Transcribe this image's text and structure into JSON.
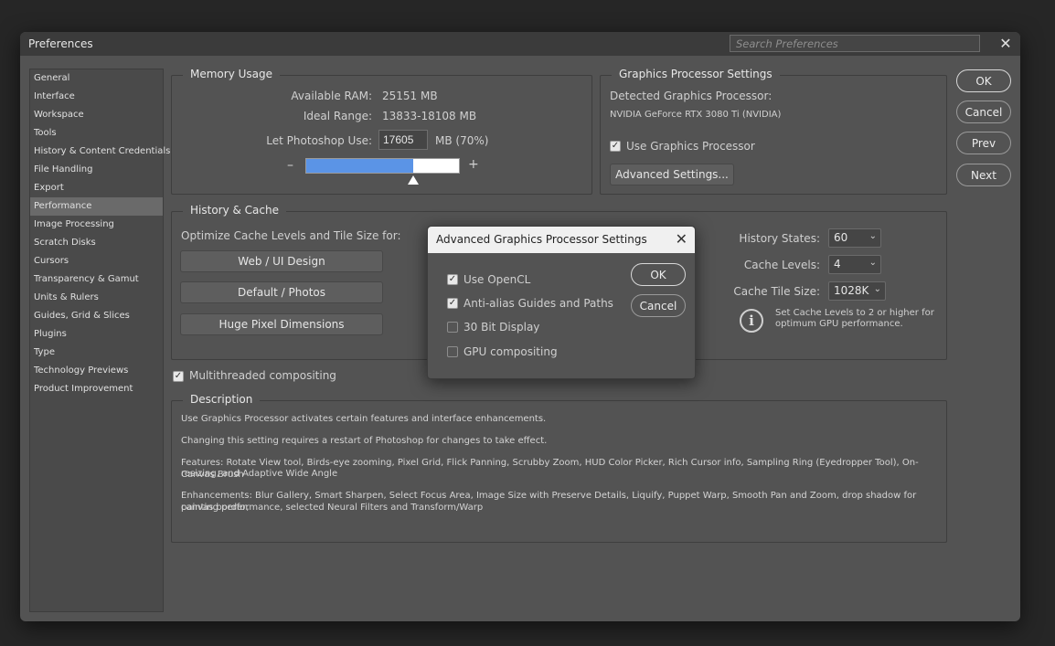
{
  "window": {
    "title": "Preferences",
    "search_placeholder": "Search Preferences",
    "close": "✕"
  },
  "sidebar": {
    "items": [
      {
        "label": "General"
      },
      {
        "label": "Interface"
      },
      {
        "label": "Workspace"
      },
      {
        "label": "Tools"
      },
      {
        "label": "History & Content Credentials"
      },
      {
        "label": "File Handling"
      },
      {
        "label": "Export"
      },
      {
        "label": "Performance",
        "active": true
      },
      {
        "label": "Image Processing"
      },
      {
        "label": "Scratch Disks"
      },
      {
        "label": "Cursors"
      },
      {
        "label": "Transparency & Gamut"
      },
      {
        "label": "Units & Rulers"
      },
      {
        "label": "Guides, Grid & Slices"
      },
      {
        "label": "Plugins"
      },
      {
        "label": "Type"
      },
      {
        "label": "Technology Previews"
      },
      {
        "label": "Product Improvement"
      }
    ]
  },
  "memory": {
    "title": "Memory Usage",
    "available_label": "Available RAM:",
    "available_value": "25151 MB",
    "ideal_label": "Ideal Range:",
    "ideal_value": "13833-18108 MB",
    "use_label": "Let Photoshop Use:",
    "use_value": "17605",
    "use_unit": "MB (70%)",
    "minus": "–",
    "plus": "+",
    "slider_fraction": 0.7
  },
  "gpu": {
    "title": "Graphics Processor Settings",
    "detected_label": "Detected Graphics Processor:",
    "detected_value": "NVIDIA GeForce RTX 3080 Ti (NVIDIA)",
    "use_gpu_label": "Use Graphics Processor",
    "use_gpu_checked": true,
    "advanced_button": "Advanced Settings..."
  },
  "history_cache": {
    "title": "History & Cache",
    "optimize_label": "Optimize Cache Levels and Tile Size for:",
    "presets": [
      "Web / UI Design",
      "Default / Photos",
      "Huge Pixel Dimensions"
    ],
    "history_states_label": "History States:",
    "history_states_value": "60",
    "cache_levels_label": "Cache Levels:",
    "cache_levels_value": "4",
    "cache_tile_label": "Cache Tile Size:",
    "cache_tile_value": "1028K",
    "info_text_1": "Set Cache Levels to 2 or higher for",
    "info_text_2": "optimum GPU performance."
  },
  "multithreaded": {
    "label": "Multithreaded compositing",
    "checked": true
  },
  "description": {
    "title": "Description",
    "lines": [
      "Use Graphics Processor activates certain features and interface enhancements.",
      "Changing this setting requires a restart of Photoshop for changes to take effect.",
      "Features: Rotate View tool, Birds-eye zooming, Pixel Grid, Flick Panning, Scrubby Zoom, HUD Color Picker, Rich Cursor info, Sampling Ring (Eyedropper Tool), On-Canvas Brush",
      "resizing, and Adaptive Wide Angle",
      "Enhancements: Blur Gallery, Smart Sharpen, Select Focus Area, Image Size with Preserve Details, Liquify, Puppet Warp, Smooth Pan and Zoom, drop shadow for canvas border,",
      "painting performance, selected Neural Filters and Transform/Warp"
    ]
  },
  "actions": {
    "ok": "OK",
    "cancel": "Cancel",
    "prev": "Prev",
    "next": "Next"
  },
  "advanced_dialog": {
    "title": "Advanced Graphics Processor Settings",
    "close": "✕",
    "options": [
      {
        "label": "Use OpenCL",
        "checked": true
      },
      {
        "label": "Anti-alias Guides and Paths",
        "checked": true
      },
      {
        "label": "30 Bit Display",
        "checked": false
      },
      {
        "label": "GPU compositing",
        "checked": false
      }
    ],
    "ok": "OK",
    "cancel": "Cancel"
  },
  "colors": {
    "accent": "#5b94e6",
    "dialog_bg": "#535353",
    "titlebar": "#3b3b3b"
  }
}
